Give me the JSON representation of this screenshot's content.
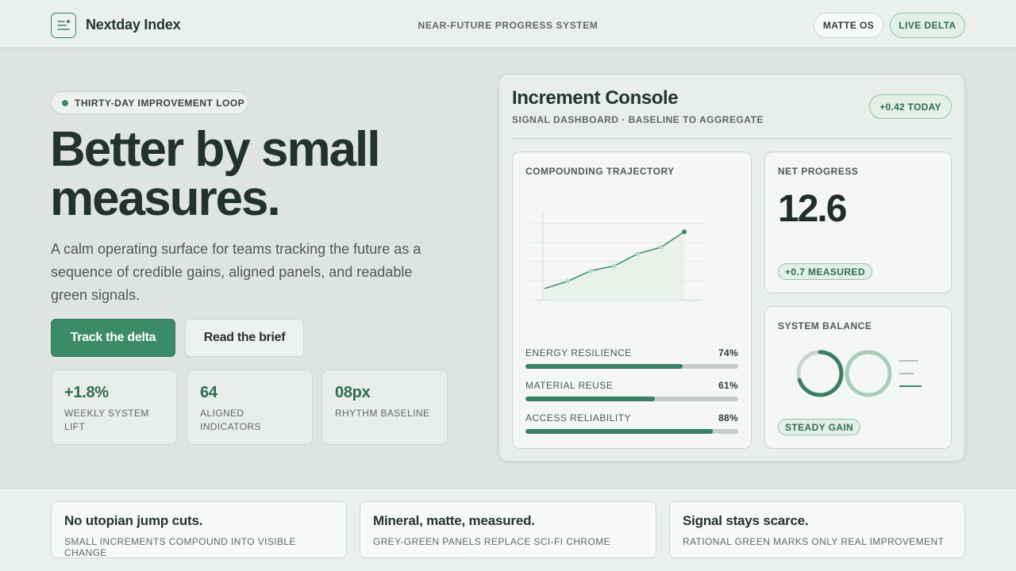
{
  "header": {
    "brand": "Nextday Index",
    "tagline": "NEAR-FUTURE PROGRESS SYSTEM",
    "buttons": [
      "MATTE OS",
      "LIVE DELTA"
    ],
    "logo_icon": "menu-lines-icon"
  },
  "hero": {
    "chip": "THIRTY-DAY IMPROVEMENT LOOP",
    "title": "Better by small measures.",
    "description": "A calm operating surface for teams tracking the future as a sequence of credible gains, aligned panels, and readable green signals.",
    "primary_button": "Track the delta",
    "secondary_button": "Read the brief",
    "stats": [
      {
        "value": "+1.8%",
        "label": "WEEKLY SYSTEM LIFT"
      },
      {
        "value": "64",
        "label": "ALIGNED INDICATORS"
      },
      {
        "value": "08px",
        "label": "RHYTHM BASELINE"
      }
    ]
  },
  "console": {
    "title": "Increment Console",
    "subtitle": "SIGNAL DASHBOARD · BASELINE TO AGGREGATE",
    "badge": "+0.42 TODAY",
    "trajectory": {
      "label": "COMPOUNDING TRAJECTORY",
      "metrics": [
        {
          "name": "ENERGY RESILIENCE",
          "pct": "74%",
          "value": 0.74
        },
        {
          "name": "MATERIAL REUSE",
          "pct": "61%",
          "value": 0.61
        },
        {
          "name": "ACCESS RELIABILITY",
          "pct": "88%",
          "value": 0.88
        }
      ]
    },
    "net": {
      "label": "NET PROGRESS",
      "value": "12.6",
      "badge": "+0.7 MEASURED"
    },
    "balance": {
      "label": "SYSTEM BALANCE",
      "badge": "STEADY GAIN",
      "ring_primary": 0.7
    }
  },
  "chart_data": {
    "type": "line",
    "title": "COMPOUNDING TRAJECTORY",
    "x": [
      1,
      2,
      3,
      4,
      5,
      6,
      7
    ],
    "values": [
      1.0,
      1.9,
      3.2,
      3.8,
      5.3,
      6.1,
      8.0
    ],
    "ylim": [
      0,
      10
    ],
    "grid": true
  },
  "footer": {
    "cards": [
      {
        "title": "No utopian jump cuts.",
        "sub": "SMALL INCREMENTS COMPOUND INTO VISIBLE CHANGE"
      },
      {
        "title": "Mineral, matte, measured.",
        "sub": "GREY-GREEN PANELS REPLACE SCI-FI CHROME"
      },
      {
        "title": "Signal stays scarce.",
        "sub": "RATIONAL GREEN MARKS ONLY REAL IMPROVEMENT"
      }
    ]
  },
  "colors": {
    "accent": "#3b8a68",
    "accent_dark": "#2e6e51",
    "background": "#dfe4e0",
    "panel": "#f4f7f5"
  }
}
